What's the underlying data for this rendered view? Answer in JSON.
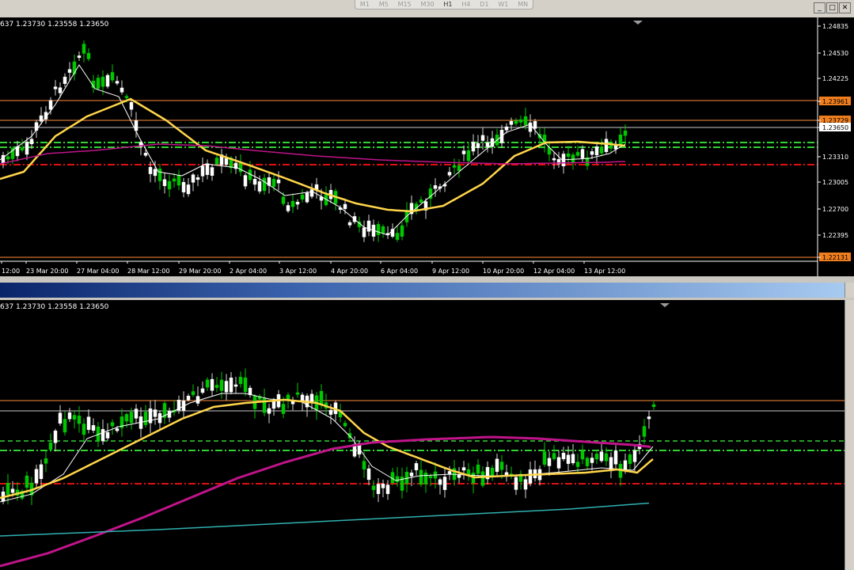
{
  "toolbar": {
    "timeframes": [
      "M1",
      "M5",
      "M15",
      "M30",
      "H1",
      "H4",
      "D1",
      "W1",
      "MN"
    ],
    "active_timeframe": "H1"
  },
  "window_buttons": [
    "_",
    "□",
    "✕"
  ],
  "chart1": {
    "ohlc": "637 1.23730 1.23558 1.23650",
    "price_axis": [
      "1.24835",
      "1.24530",
      "1.24225",
      "1.23961",
      "1.23729",
      "1.23650",
      "1.23310",
      "1.23005",
      "1.22700",
      "1.22395",
      "1.22131"
    ],
    "time_axis": [
      "12:00",
      "23 Mar 20:00",
      "27 Mar 04:00",
      "28 Mar 12:00",
      "29 Mar 20:00",
      "2 Apr 04:00",
      "3 Apr 12:00",
      "4 Apr 20:00",
      "6 Apr 04:00",
      "9 Apr 12:00",
      "10 Apr 20:00",
      "12 Apr 04:00",
      "13 Apr 12:00"
    ],
    "badges": {
      "upper": "1.23961",
      "mid": "1.23729",
      "current": "1.23650",
      "lower": "1.22131"
    }
  },
  "chart2": {
    "ohlc": "637 1.23730 1.23558 1.23650"
  },
  "colors": {
    "bull": "#00c800",
    "bear": "#ffffff",
    "ma_white": "#ffffff",
    "ma_yellow": "#ffd54a",
    "ma_magenta": "#c0148a",
    "ma_teal": "#30b0b0",
    "level_orange": "#ff8c3c",
    "level_green": "#32d232",
    "level_red": "#e01010",
    "badge": "#f07e1e"
  },
  "icons": {
    "chart_shift": "triangle-down-icon"
  }
}
